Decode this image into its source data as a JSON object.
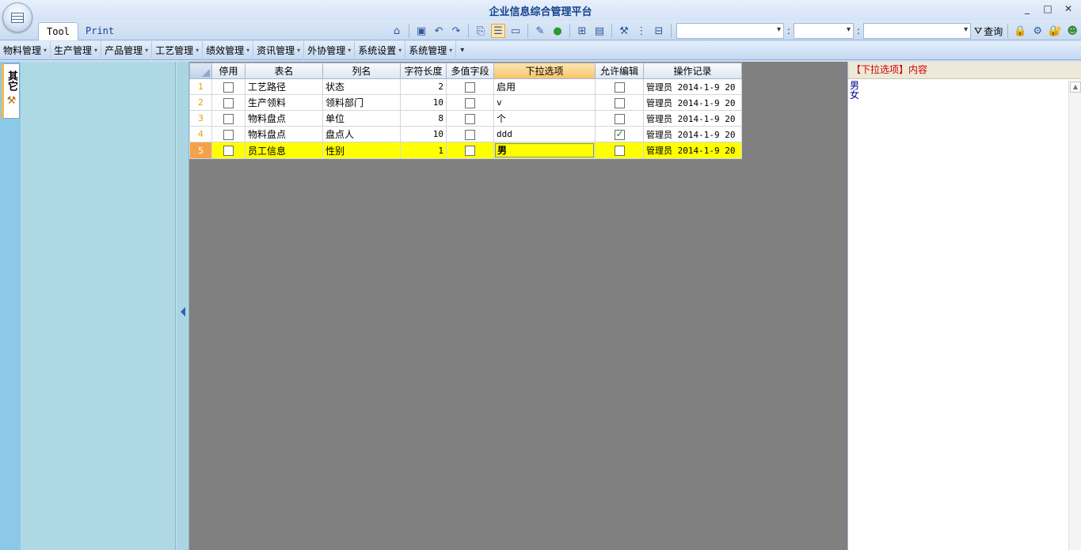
{
  "window": {
    "title": "企业信息综合管理平台",
    "buttons": [
      "_",
      "□",
      "✕"
    ]
  },
  "tabs": [
    {
      "label": "Tool",
      "active": true
    },
    {
      "label": "Print",
      "active": false
    }
  ],
  "toolbar": {
    "query_label": "查询",
    "combo_separator": ":"
  },
  "menu": {
    "items": [
      "物料管理",
      "生产管理",
      "产品管理",
      "工艺管理",
      "绩效管理",
      "资讯管理",
      "外协管理",
      "系统设置",
      "系统管理"
    ],
    "more": "▾"
  },
  "left_strip": {
    "tab_label": "其它"
  },
  "grid": {
    "columns": [
      "停用",
      "表名",
      "列名",
      "字符长度",
      "多值字段",
      "下拉选项",
      "允许编辑",
      "操作记录"
    ],
    "selected_column": "下拉选项",
    "rows": [
      {
        "num": "1",
        "disabled": false,
        "table": "工艺路径",
        "column": "状态",
        "length": "2",
        "multi": false,
        "options": "启用",
        "editable": false,
        "log": "管理员  2014-1-9 20"
      },
      {
        "num": "2",
        "disabled": false,
        "table": "生产领料",
        "column": "领料部门",
        "length": "10",
        "multi": false,
        "options": "v",
        "editable": false,
        "log": "管理员  2014-1-9 20"
      },
      {
        "num": "3",
        "disabled": false,
        "table": "物料盘点",
        "column": "单位",
        "length": "8",
        "multi": false,
        "options": "个",
        "editable": false,
        "log": "管理员  2014-1-9 20"
      },
      {
        "num": "4",
        "disabled": false,
        "table": "物料盘点",
        "column": "盘点人",
        "length": "10",
        "multi": false,
        "options": "ddd",
        "editable": true,
        "log": "管理员  2014-1-9 20"
      },
      {
        "num": "5",
        "disabled": false,
        "table": "员工信息",
        "column": "性别",
        "length": "1",
        "multi": false,
        "options": "男",
        "editable": false,
        "log": "管理员  2014-1-9 20",
        "current": true
      }
    ]
  },
  "right_panel": {
    "header": "【下拉选项】内容",
    "lines": [
      "男",
      "女"
    ]
  },
  "colors": {
    "current_row": "#ffff00",
    "grid_background": "#808080",
    "nav_panel": "#aed9e4",
    "header_text": "#d10000"
  }
}
